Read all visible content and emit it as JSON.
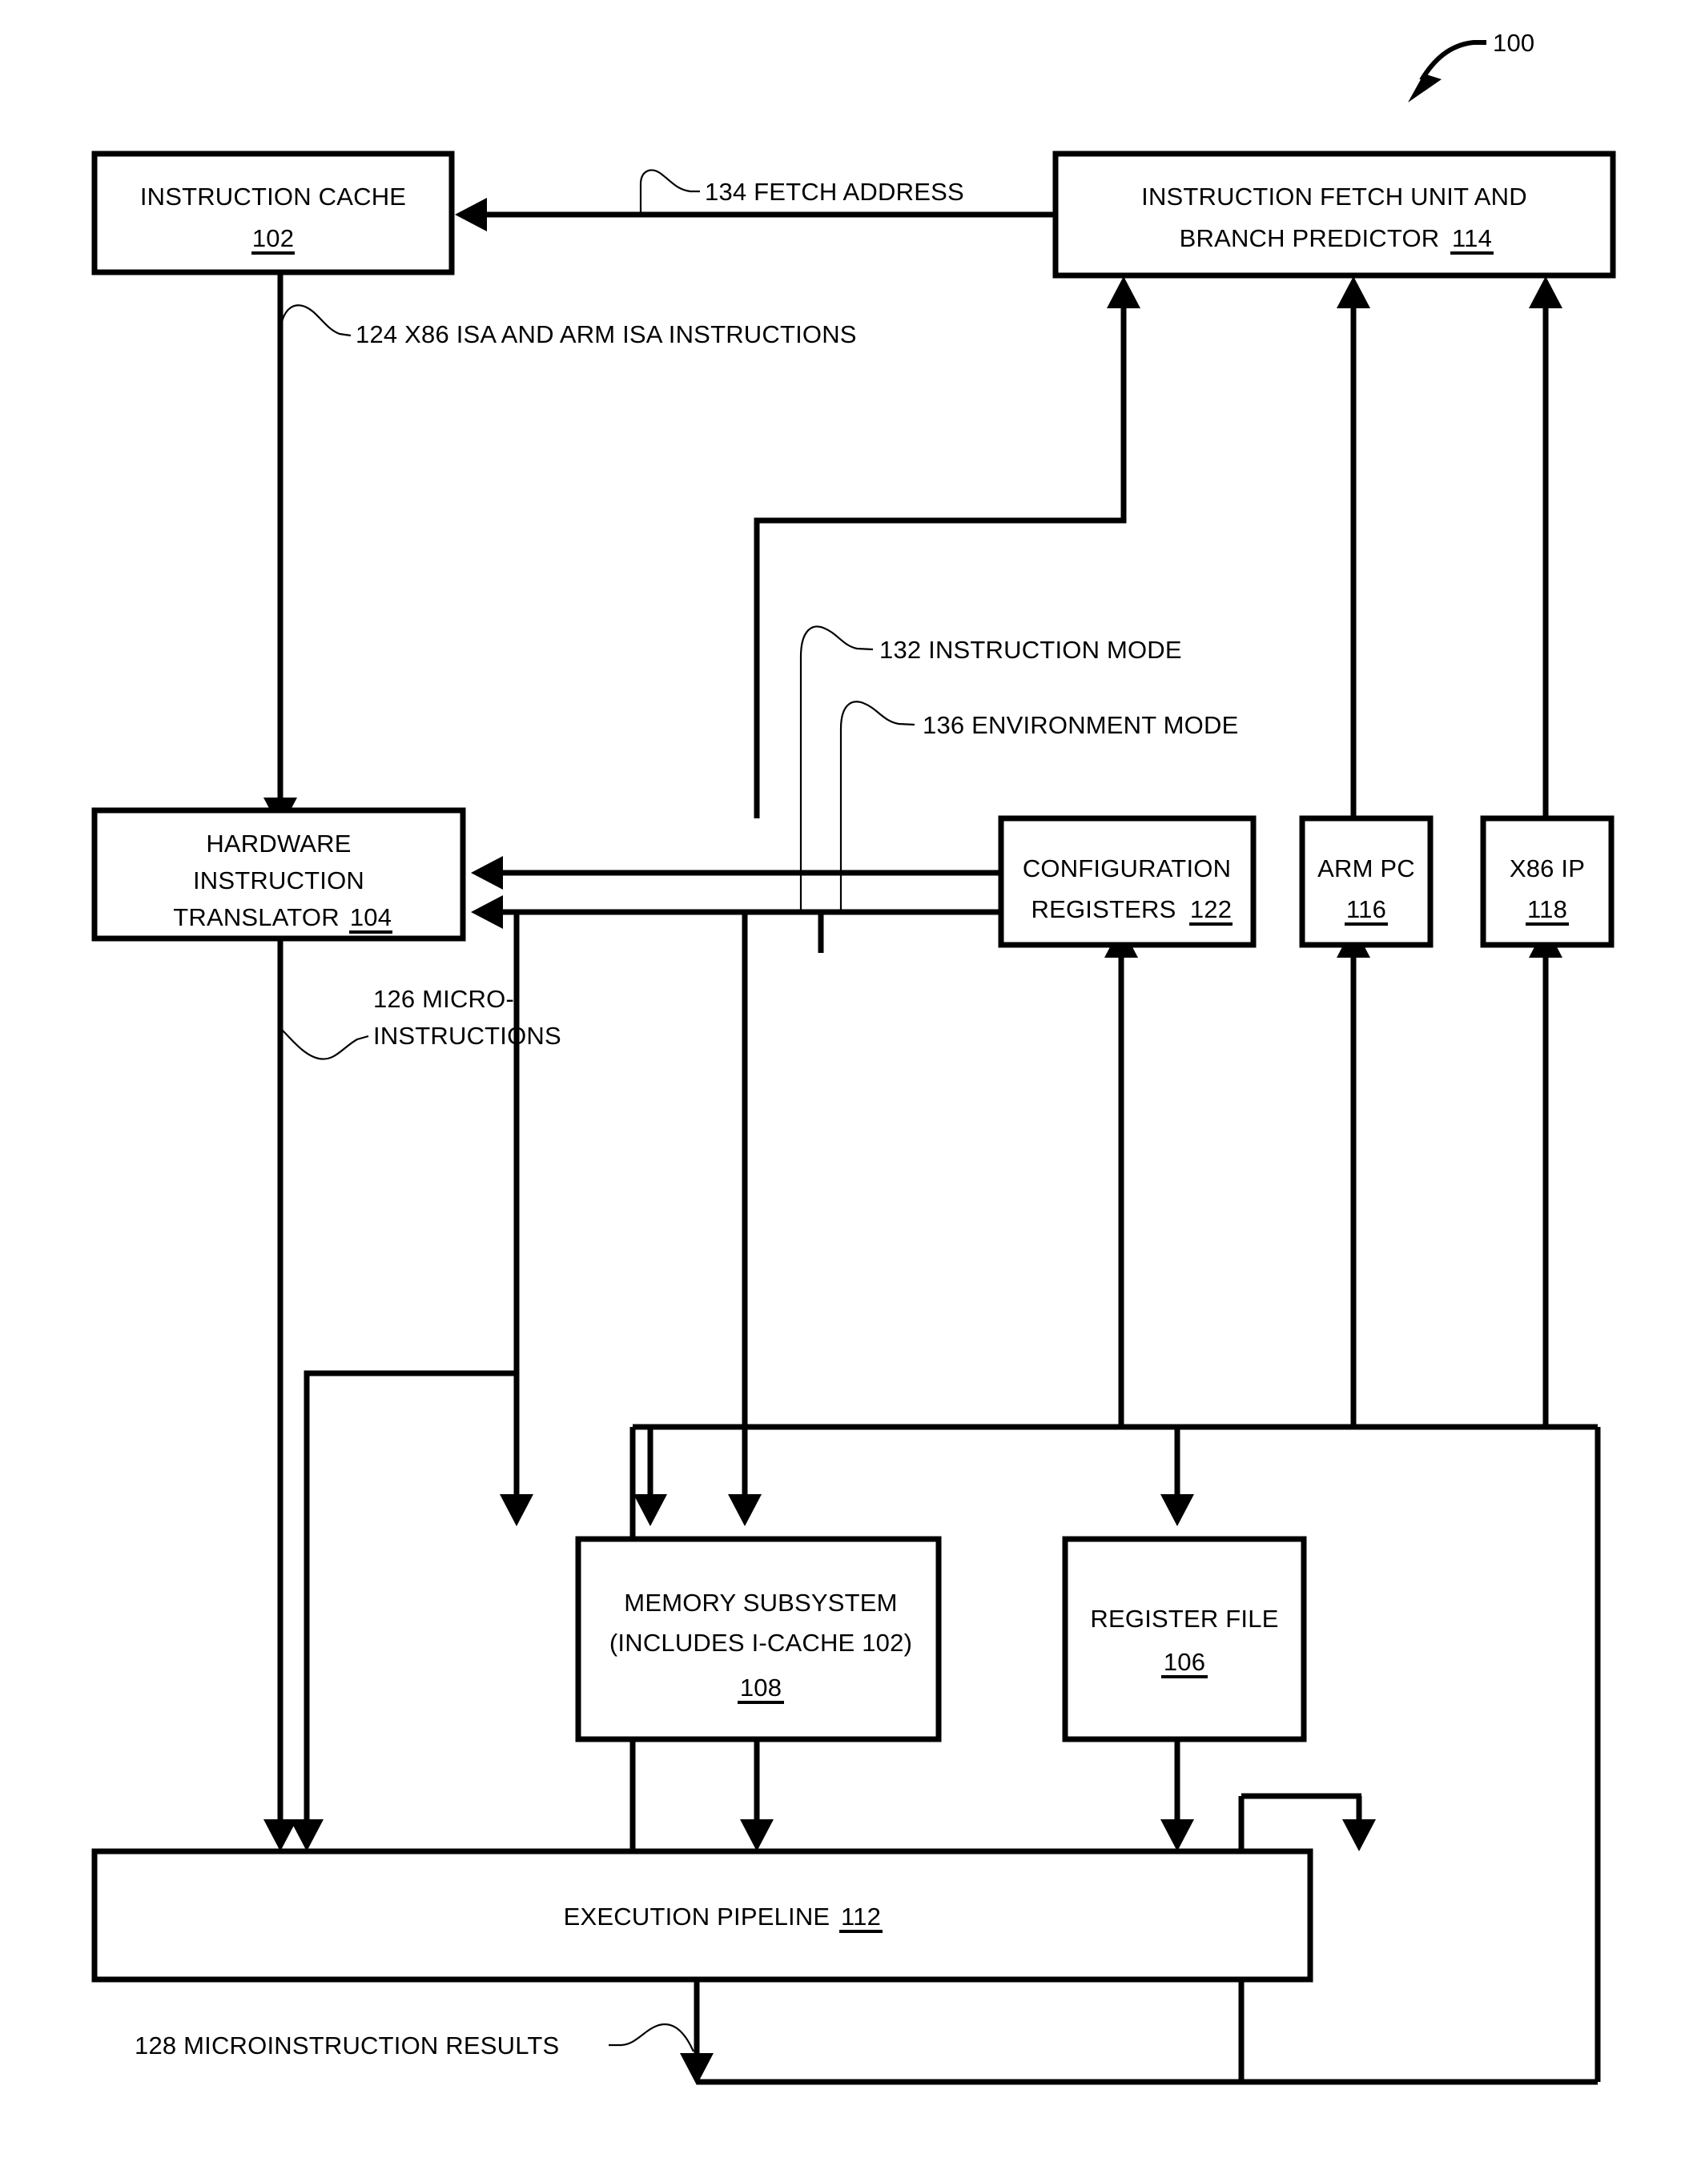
{
  "figure": {
    "figure_number": "100",
    "blocks": [
      {
        "id": "102",
        "lines": [
          "INSTRUCTION CACHE"
        ],
        "ref": "102"
      },
      {
        "id": "114",
        "lines": [
          "INSTRUCTION FETCH UNIT AND",
          "BRANCH PREDICTOR"
        ],
        "ref": "114"
      },
      {
        "id": "104",
        "lines": [
          "HARDWARE",
          "INSTRUCTION",
          "TRANSLATOR"
        ],
        "ref": "104"
      },
      {
        "id": "122",
        "lines": [
          "CONFIGURATION",
          "REGISTERS"
        ],
        "ref": "122"
      },
      {
        "id": "116",
        "lines": [
          "ARM PC"
        ],
        "ref": "116"
      },
      {
        "id": "118",
        "lines": [
          "X86 IP"
        ],
        "ref": "118"
      },
      {
        "id": "108",
        "lines": [
          "MEMORY SUBSYSTEM",
          "(INCLUDES I-CACHE 102)"
        ],
        "ref": "108"
      },
      {
        "id": "106",
        "lines": [
          "REGISTER FILE"
        ],
        "ref": "106"
      },
      {
        "id": "112",
        "lines": [
          "EXECUTION PIPELINE"
        ],
        "ref": "112"
      }
    ],
    "signals": [
      {
        "id": "134",
        "label": "134 FETCH ADDRESS"
      },
      {
        "id": "124",
        "label": "124 X86 ISA AND ARM ISA INSTRUCTIONS"
      },
      {
        "id": "132",
        "label": "132 INSTRUCTION MODE"
      },
      {
        "id": "136",
        "label": "136 ENVIRONMENT MODE"
      },
      {
        "id": "126",
        "label_line1": "126 MICRO-",
        "label_line2": "INSTRUCTIONS"
      },
      {
        "id": "128",
        "label": "128 MICROINSTRUCTION RESULTS"
      }
    ],
    "box_text": {
      "instruction_cache": "INSTRUCTION CACHE",
      "instruction_cache_ref": "102",
      "fetch_unit_l1": "INSTRUCTION FETCH UNIT AND",
      "fetch_unit_l2": "BRANCH PREDICTOR",
      "fetch_unit_ref": "114",
      "translator_l1": "HARDWARE",
      "translator_l2": "INSTRUCTION",
      "translator_l3": "TRANSLATOR",
      "translator_ref": "104",
      "config_l1": "CONFIGURATION",
      "config_l2": "REGISTERS",
      "config_ref": "122",
      "arm_pc": "ARM PC",
      "arm_pc_ref": "116",
      "x86_ip": "X86 IP",
      "x86_ip_ref": "118",
      "memsub_l1": "MEMORY SUBSYSTEM",
      "memsub_l2": "(INCLUDES I-CACHE 102)",
      "memsub_ref": "108",
      "regfile": "REGISTER FILE",
      "regfile_ref": "106",
      "exec_pipeline": "EXECUTION PIPELINE",
      "exec_pipeline_ref": "112"
    },
    "callouts": {
      "fig_num": "100",
      "fetch_address": "134 FETCH ADDRESS",
      "isa_instructions": "124 X86 ISA AND ARM ISA INSTRUCTIONS",
      "instruction_mode": "132 INSTRUCTION MODE",
      "environment_mode": "136 ENVIRONMENT MODE",
      "micro_line1": "126 MICRO-",
      "micro_line2": "INSTRUCTIONS",
      "micro_results": "128 MICROINSTRUCTION RESULTS"
    },
    "colors": {
      "line": "#000000",
      "background": "#ffffff"
    }
  }
}
